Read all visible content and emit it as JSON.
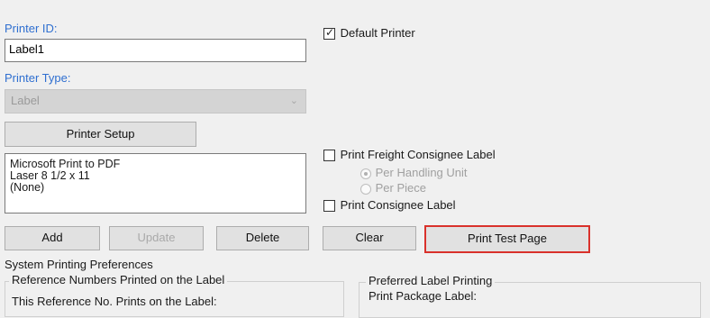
{
  "printer_id": {
    "label": "Printer ID:",
    "value": "Label1"
  },
  "printer_type": {
    "label": "Printer Type:",
    "value": "Label"
  },
  "printer_setup_button": "Printer Setup",
  "printer_info": [
    "Microsoft Print to PDF",
    "Laser 8 1/2 x 11",
    "(None)"
  ],
  "default_printer": {
    "label": "Default Printer",
    "checked": true
  },
  "print_freight_consignee": {
    "label": "Print Freight Consignee Label",
    "checked": false
  },
  "consignee_options": [
    {
      "label": "Per Handling Unit",
      "selected": true
    },
    {
      "label": "Per Piece",
      "selected": false
    }
  ],
  "print_consignee": {
    "label": "Print Consignee Label",
    "checked": false
  },
  "buttons": {
    "add": "Add",
    "update": "Update",
    "delete": "Delete",
    "clear": "Clear",
    "print_test_page": "Print Test Page"
  },
  "highlight_color": "#d9312b",
  "system_prefs": {
    "title": "System Printing Preferences",
    "reference_group": "Reference Numbers Printed on the Label",
    "reference_text": "This Reference No. Prints on the Label:",
    "preferred_group": "Preferred Label Printing",
    "print_package_label": "Print Package Label:"
  }
}
